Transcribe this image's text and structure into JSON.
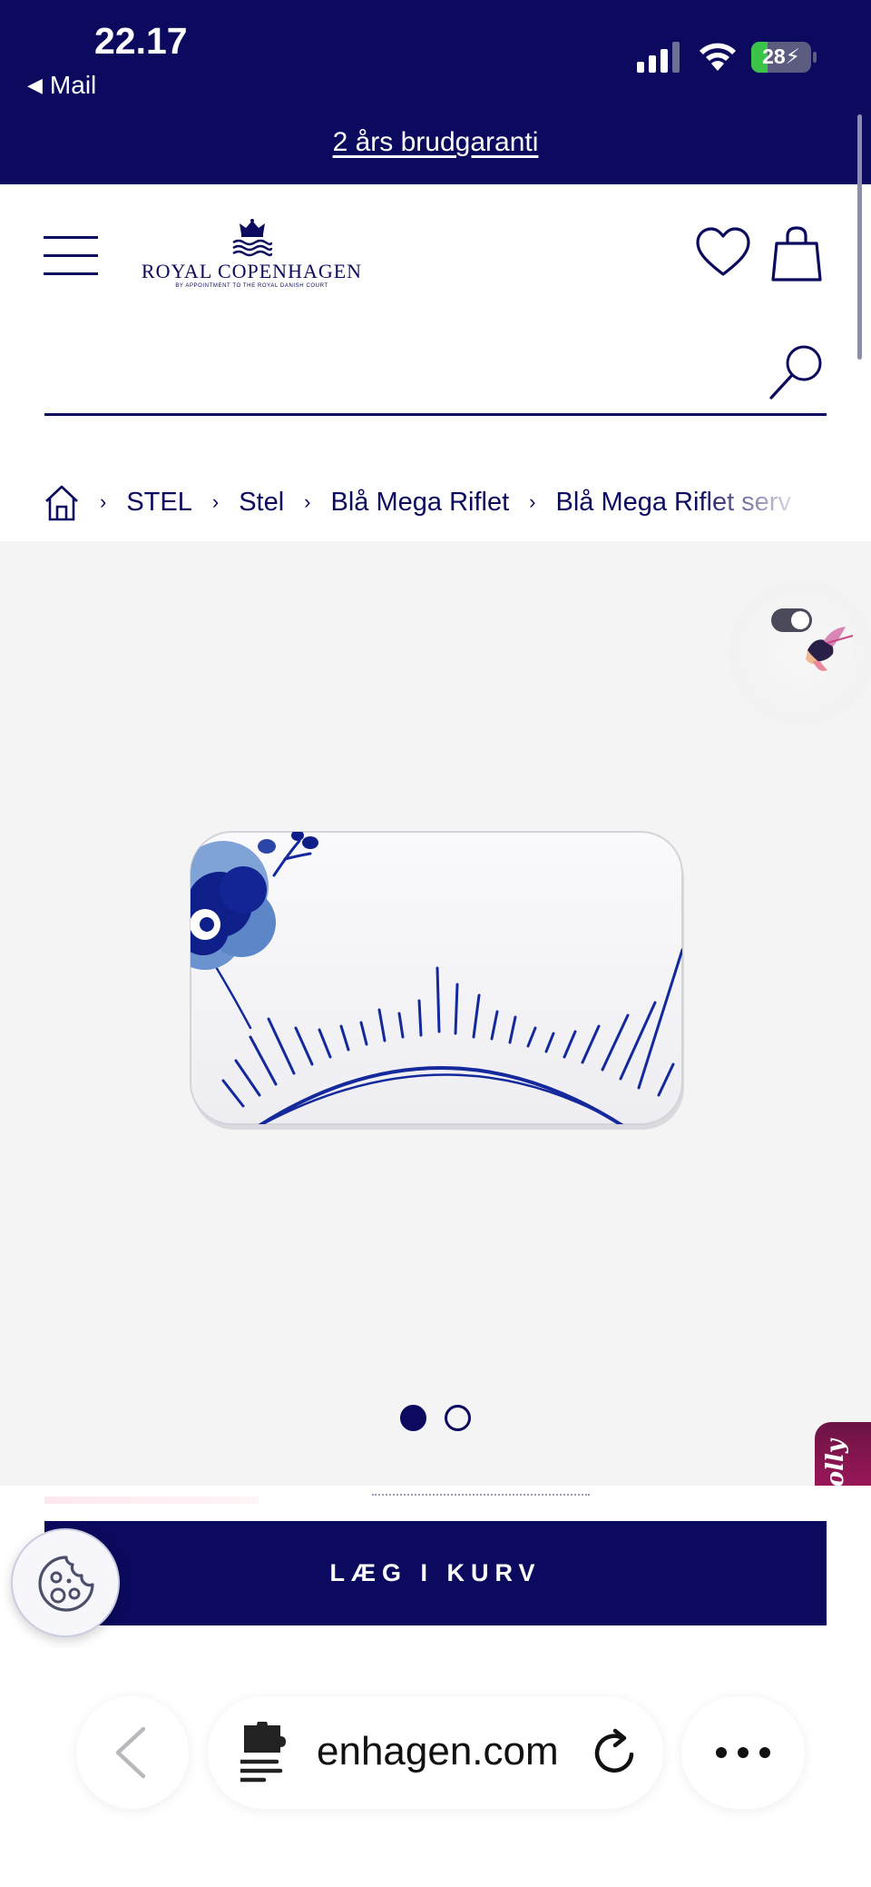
{
  "status_bar": {
    "time": "22.17",
    "back_app": "Mail",
    "battery_percent": "28",
    "battery_level": 0.28
  },
  "banner": {
    "text": "2 års brudgaranti"
  },
  "header": {
    "logo_brand": "ROYAL COPENHAGEN",
    "logo_tagline": "BY APPOINTMENT TO THE ROYAL DANISH COURT",
    "search_placeholder": ""
  },
  "breadcrumb": {
    "items": [
      "STEL",
      "Stel",
      "Blå Mega Riflet",
      "Blå Mega Riflet serv"
    ]
  },
  "gallery": {
    "image_count": 2,
    "active_index": 0
  },
  "actions": {
    "add_to_cart": "LÆG I KURV",
    "molly_label": "Molly"
  },
  "browser": {
    "url": "enhagen.com"
  },
  "colors": {
    "brand_navy": "#0b0a5e",
    "gallery_bg": "#f4f4f5",
    "molly_pink": "#c3186a",
    "battery_green": "#3cc34a"
  }
}
